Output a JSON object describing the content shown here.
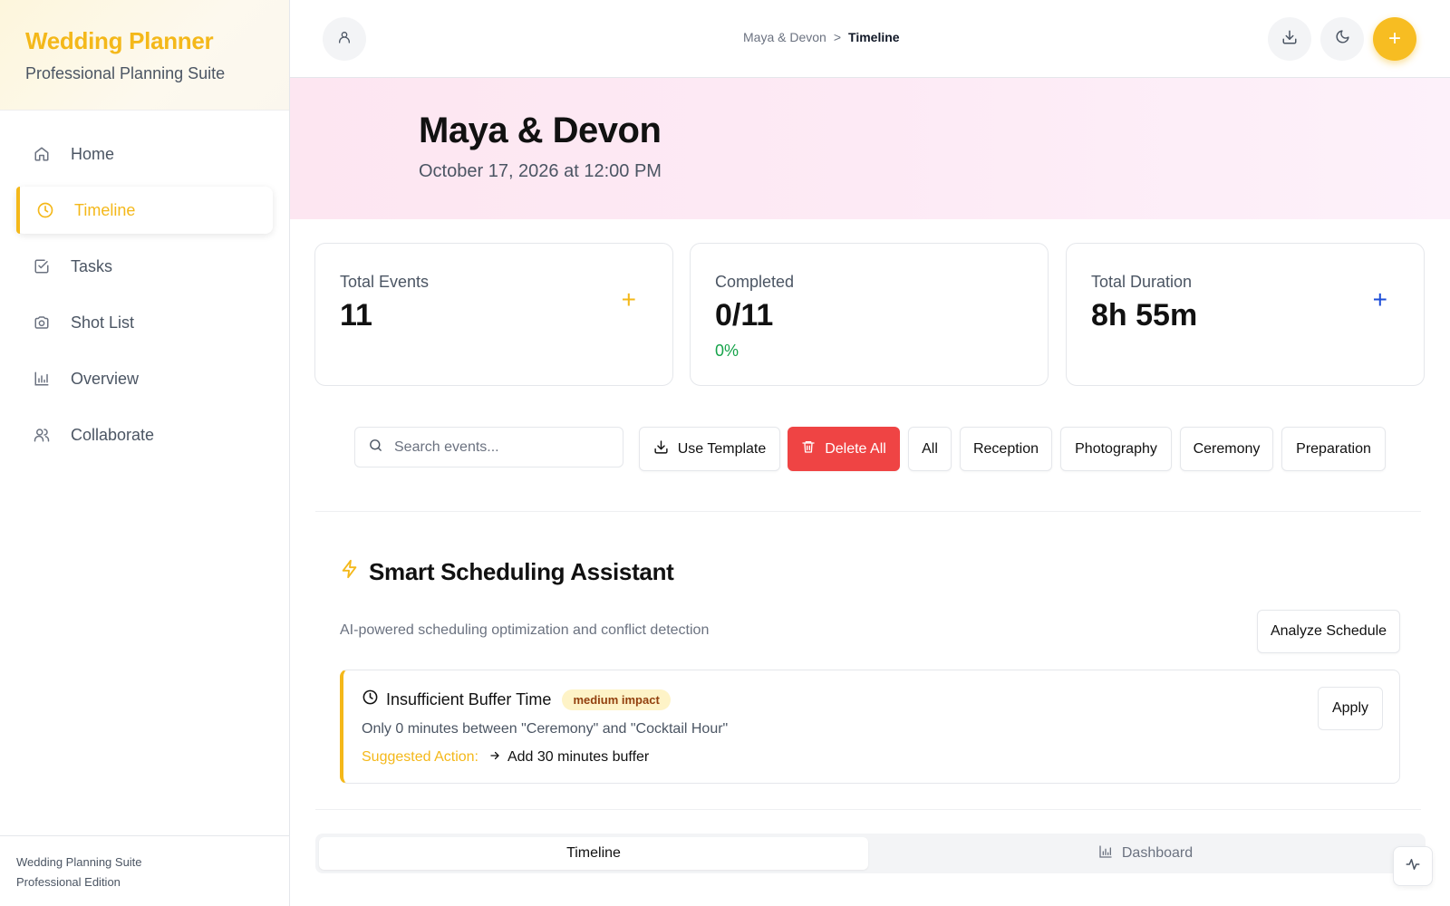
{
  "sidebar": {
    "brand_title": "Wedding Planner",
    "brand_subtitle": "Professional Planning Suite",
    "items": [
      {
        "label": "Home",
        "icon": "home-icon"
      },
      {
        "label": "Timeline",
        "icon": "clock-icon",
        "active": true
      },
      {
        "label": "Tasks",
        "icon": "checkbox-icon"
      },
      {
        "label": "Shot List",
        "icon": "camera-icon"
      },
      {
        "label": "Overview",
        "icon": "bar-chart-icon"
      },
      {
        "label": "Collaborate",
        "icon": "users-icon"
      }
    ],
    "footer_line1": "Wedding Planning Suite",
    "footer_line2": "Professional Edition"
  },
  "topbar": {
    "breadcrumb_parent": "Maya & Devon",
    "breadcrumb_separator": ">",
    "breadcrumb_current": "Timeline",
    "add_label": "+"
  },
  "hero": {
    "title": "Maya & Devon",
    "subtitle": "October 17, 2026 at 12:00 PM"
  },
  "stats": {
    "total_events_label": "Total Events",
    "total_events_value": "11",
    "completed_label": "Completed",
    "completed_value": "0/11",
    "completed_pct": "0%",
    "duration_label": "Total Duration",
    "duration_value": "8h 55m",
    "plus": "+"
  },
  "toolbar": {
    "search_placeholder": "Search events...",
    "use_template": "Use Template",
    "delete_all": "Delete All",
    "filters": [
      "All",
      "Reception",
      "Photography",
      "Ceremony",
      "Preparation"
    ]
  },
  "assistant": {
    "title": "Smart Scheduling Assistant",
    "description": "AI-powered scheduling optimization and conflict detection",
    "analyze": "Analyze Schedule",
    "suggestion": {
      "title": "Insufficient Buffer Time",
      "badge": "medium impact",
      "description": "Only 0 minutes between \"Ceremony\" and \"Cocktail Hour\"",
      "action_label": "Suggested Action:",
      "action_value": "Add 30 minutes buffer",
      "apply": "Apply"
    }
  },
  "tabs": {
    "timeline": "Timeline",
    "dashboard": "Dashboard"
  },
  "colors": {
    "accent": "#f4b81a",
    "danger": "#ef4444",
    "success": "#16a34a",
    "info": "#1d4ed8"
  }
}
